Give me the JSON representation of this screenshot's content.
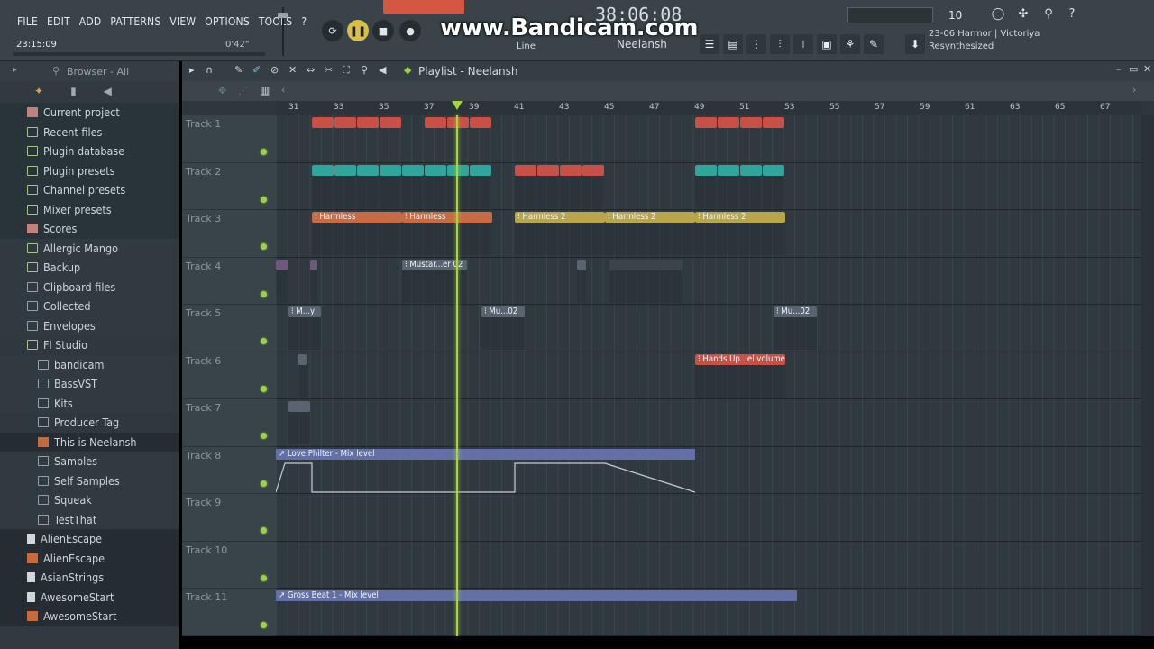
{
  "menu": [
    "FILE",
    "EDIT",
    "ADD",
    "PATTERNS",
    "VIEW",
    "OPTIONS",
    "TOOLS",
    "?"
  ],
  "hint": {
    "time": "23:15:09",
    "length": "0'42\""
  },
  "transport": {
    "clock": "38:06:08",
    "snap": "Line",
    "pattern": "Neelansh",
    "tempo_num": "10"
  },
  "overlay": {
    "watermark": "www.Bandicam.com"
  },
  "hint_panel": {
    "line1": "23-06  Harmor | Victoriya",
    "line2": "Resynthesized"
  },
  "browser": {
    "title": "Browser - All",
    "items": [
      {
        "label": "Current project",
        "icon": "pink",
        "depth": 0,
        "style": "top"
      },
      {
        "label": "Recent files",
        "icon": "folder",
        "depth": 0,
        "style": "top"
      },
      {
        "label": "Plugin database",
        "icon": "plug",
        "depth": 0,
        "style": "top"
      },
      {
        "label": "Plugin presets",
        "icon": "plug",
        "depth": 0,
        "style": "top"
      },
      {
        "label": "Channel presets",
        "icon": "plug",
        "depth": 0,
        "style": "top"
      },
      {
        "label": "Mixer presets",
        "icon": "plug",
        "depth": 0,
        "style": "top"
      },
      {
        "label": "Scores",
        "icon": "note",
        "depth": 0,
        "style": "top"
      },
      {
        "label": "Allergic Mango",
        "icon": "folder",
        "depth": 0,
        "style": ""
      },
      {
        "label": "Backup",
        "icon": "folder",
        "depth": 0,
        "style": ""
      },
      {
        "label": "Clipboard files",
        "icon": "folder-g",
        "depth": 0,
        "style": ""
      },
      {
        "label": "Collected",
        "icon": "folder-g",
        "depth": 0,
        "style": ""
      },
      {
        "label": "Envelopes",
        "icon": "folder-g",
        "depth": 0,
        "style": ""
      },
      {
        "label": "Fl Studio",
        "icon": "folder",
        "depth": 0,
        "style": "sel"
      },
      {
        "label": "bandicam",
        "icon": "folder-g",
        "depth": 1,
        "style": ""
      },
      {
        "label": "BassVST",
        "icon": "folder-g",
        "depth": 1,
        "style": ""
      },
      {
        "label": "Kits",
        "icon": "folder-g",
        "depth": 1,
        "style": ""
      },
      {
        "label": "Producer Tag",
        "icon": "folder-g",
        "depth": 1,
        "style": "sel"
      },
      {
        "label": "This is Neelansh",
        "icon": "orange",
        "depth": 1,
        "style": "file"
      },
      {
        "label": "Samples",
        "icon": "folder-g",
        "depth": 1,
        "style": ""
      },
      {
        "label": "Self Samples",
        "icon": "folder-g",
        "depth": 1,
        "style": ""
      },
      {
        "label": "Squeak",
        "icon": "folder-g",
        "depth": 1,
        "style": ""
      },
      {
        "label": "TestThat",
        "icon": "folder-g",
        "depth": 1,
        "style": ""
      },
      {
        "label": "AlienEscape",
        "icon": "file",
        "depth": 0,
        "style": "file"
      },
      {
        "label": "AlienEscape",
        "icon": "orange",
        "depth": 0,
        "style": "file"
      },
      {
        "label": "AsianStrings",
        "icon": "file",
        "depth": 0,
        "style": "file"
      },
      {
        "label": "AwesomeStart",
        "icon": "file",
        "depth": 0,
        "style": "file"
      },
      {
        "label": "AwesomeStart",
        "icon": "orange",
        "depth": 0,
        "style": "file"
      }
    ]
  },
  "playlist": {
    "title": "Playlist - Neelansh",
    "ruler": [
      "31",
      "33",
      "35",
      "37",
      "39",
      "41",
      "43",
      "45",
      "47",
      "49",
      "51",
      "53",
      "55",
      "57",
      "59",
      "61",
      "63",
      "65",
      "67"
    ],
    "tracks": [
      "Track 1",
      "Track 2",
      "Track 3",
      "Track 4",
      "Track 5",
      "Track 6",
      "Track 7",
      "Track 8",
      "Track 9",
      "Track 10",
      "Track 11"
    ],
    "clips": {
      "harmless": "Harmless",
      "harmless2": "Harmless 2",
      "mustard": "Mustar...er 02",
      "my": "M...y",
      "mu02": "Mu...02",
      "hands_up": "Hands Up...el volume",
      "love_philter": "Love Philter - Mix level",
      "gross_beat": "Gross Beat 1 - Mix level"
    }
  },
  "colors": {
    "pattern_red": "#c85046",
    "pattern_teal": "#2fa69c",
    "pattern_orange": "#c76b45",
    "pattern_yellow": "#b9a64a",
    "automation": "#6370a8",
    "playhead": "#a5d63a"
  }
}
